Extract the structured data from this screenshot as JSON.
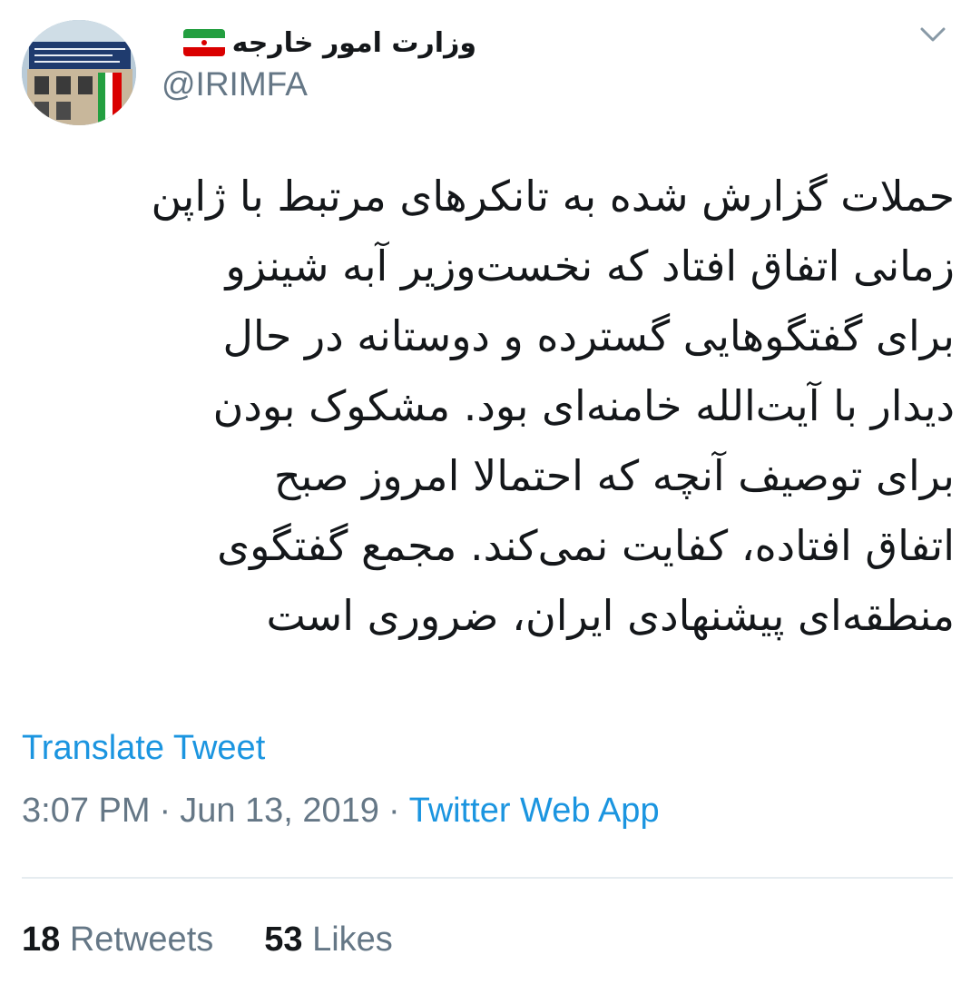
{
  "account": {
    "display_name": "وزارت امور خارجه",
    "flag_icon": "iran-flag-icon",
    "handle": "@IRIMFA"
  },
  "menu": {
    "icon": "chevron-down-icon"
  },
  "tweet": {
    "lines": [
      "حملات گزارش شده به تانکرهای مرتبط با ژاپن",
      "زمانی اتفاق افتاد که نخست‌وزیر آبه شینزو",
      "برای گفتگوهایی گسترده و دوستانه در حال",
      "دیدار با آیت‌الله خامنه‌ای بود. مشکوک بودن",
      "برای توصیف آنچه که احتمالا امروز صبح",
      "اتفاق افتاده، کفایت نمی‌کند. مجمع گفتگوی",
      "منطقه‌ای پیشنهادی ایران، ضروری است"
    ],
    "translate_label": "Translate Tweet",
    "time": "3:07 PM",
    "separator": "·",
    "date": "Jun 13, 2019",
    "source": "Twitter Web App"
  },
  "stats": {
    "retweets_count": "18",
    "retweets_label": "Retweets",
    "likes_count": "53",
    "likes_label": "Likes"
  },
  "colors": {
    "text": "#14171a",
    "secondary": "#657786",
    "link": "#1b95e0",
    "divider": "#e6ecf0"
  }
}
